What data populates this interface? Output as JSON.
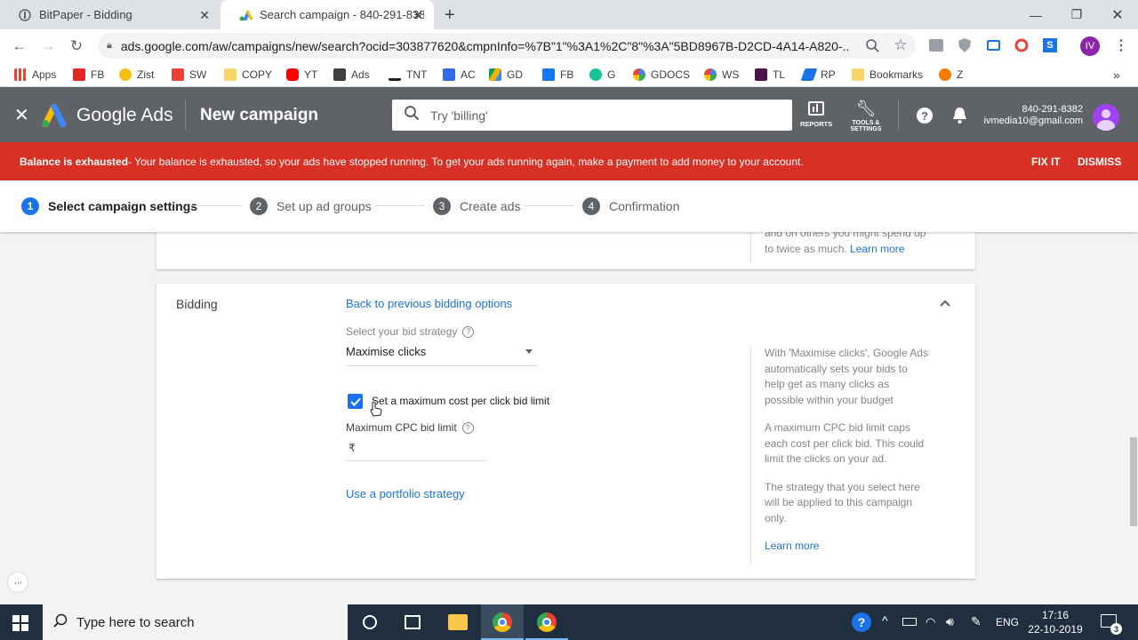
{
  "browser": {
    "tabs": [
      {
        "title": "BitPaper - Bidding"
      },
      {
        "title": "Search campaign - 840-291-838"
      }
    ],
    "url": "ads.google.com/aw/campaigns/new/search?ocid=303877620&cmpnInfo=%7B\"1\"%3A1%2C\"8\"%3A\"5BD8967B-D2CD-4A14-A820-...",
    "profile_initials": "IV",
    "bookmarks": [
      "Apps",
      "FB",
      "Zist",
      "SW",
      "COPY",
      "YT",
      "Ads",
      "TNT",
      "AC",
      "GD",
      "FB",
      "G",
      "GDOCS",
      "WS",
      "TL",
      "RP",
      "Bookmarks",
      "Z"
    ],
    "bookmarks_more": "»"
  },
  "ads": {
    "brand": "Google Ads",
    "page_title": "New campaign",
    "search_placeholder": "Try 'billing'",
    "reports_label": "REPORTS",
    "tools_label_1": "TOOLS &",
    "tools_label_2": "SETTINGS",
    "account_id": "840-291-8382",
    "account_email": "ivmedia10@gmail.com"
  },
  "banner": {
    "bold": "Balance is exhausted",
    "text": " - Your balance is exhausted, so your ads have stopped running. To get your ads running again, make a payment to add money to your account.",
    "fix": "FIX IT",
    "dismiss": "DISMISS"
  },
  "steps": [
    {
      "num": "1",
      "label": "Select campaign settings"
    },
    {
      "num": "2",
      "label": "Set up ad groups"
    },
    {
      "num": "3",
      "label": "Create ads"
    },
    {
      "num": "4",
      "label": "Confirmation"
    }
  ],
  "prev_card": {
    "help_line1": "and on others you might spend up",
    "help_line2": "to twice as much. ",
    "learn_more": "Learn more"
  },
  "bidding": {
    "section_title": "Bidding",
    "back_link": "Back to previous bidding options",
    "strategy_label": "Select your bid strategy",
    "strategy_value": "Maximise clicks",
    "checkbox_label": "Set a maximum cost per click bid limit",
    "checkbox_checked": true,
    "cpc_label": "Maximum CPC bid limit",
    "currency": "₹",
    "portfolio_link": "Use a portfolio strategy",
    "help1": "With 'Maximise clicks', Google Ads automatically sets your bids to help get as many clicks as possible within your budget",
    "help2": "A maximum CPC bid limit caps each cost per click bid. This could limit the clicks on your ad.",
    "help3": "The strategy that you select here will be applied to this campaign only.",
    "learn_more": "Learn more"
  },
  "taskbar": {
    "search_placeholder": "Type here to search",
    "lang": "ENG",
    "time": "17:16",
    "date": "22-10-2019",
    "notif_count": "3"
  },
  "colors": {
    "accent": "#1a73e8",
    "banner": "#d93025",
    "header": "#5f6368"
  }
}
